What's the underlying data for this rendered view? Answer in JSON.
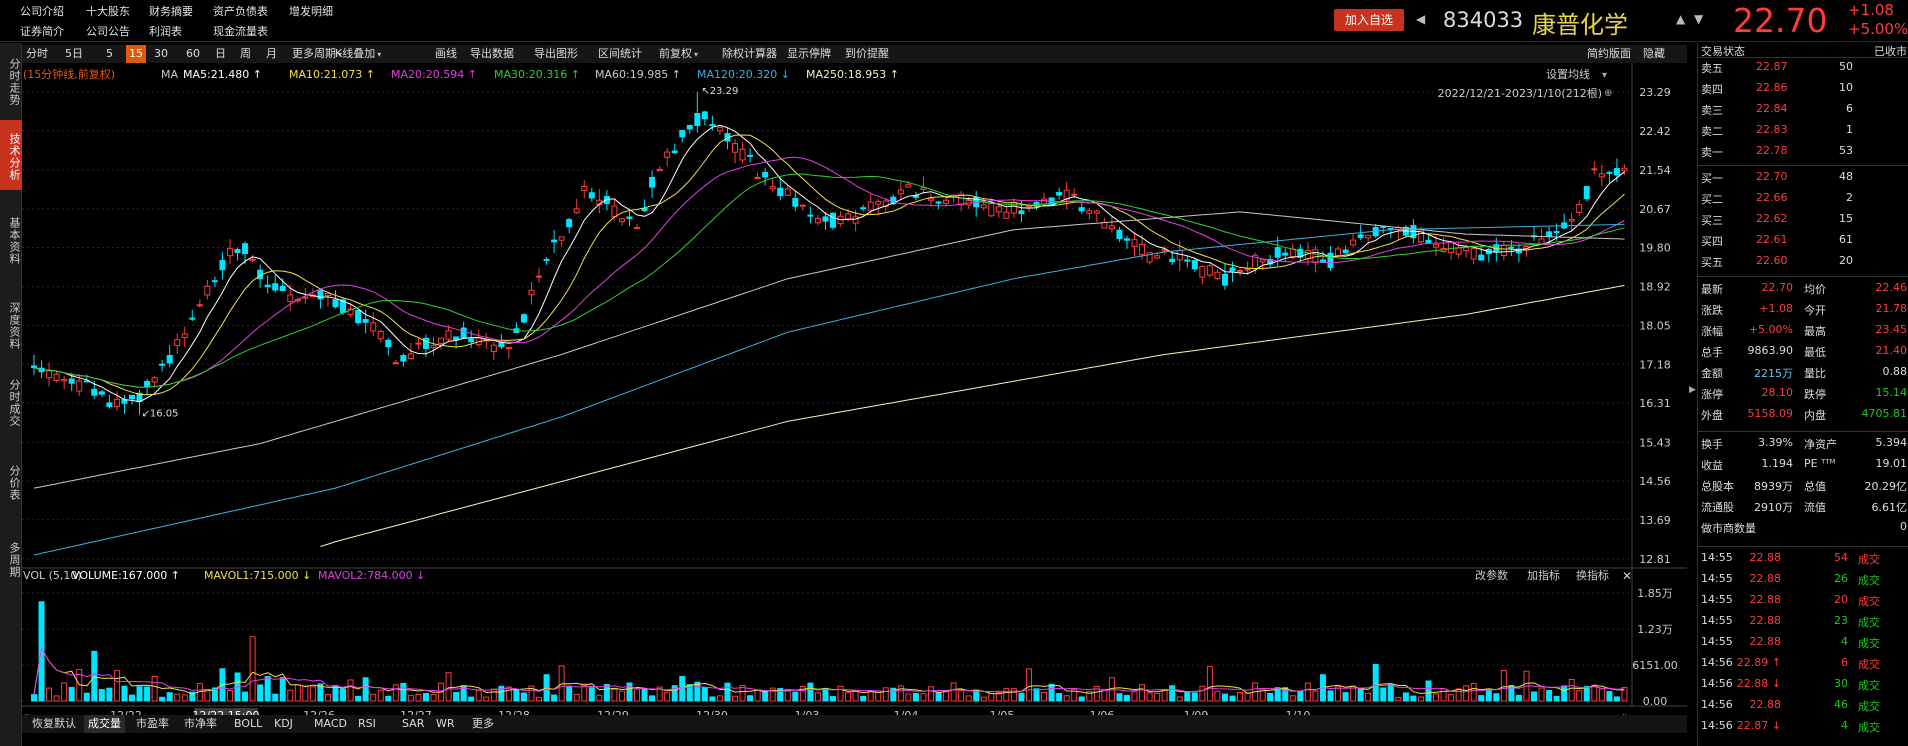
{
  "top": {
    "links_row1": [
      "公司介绍",
      "十大股东",
      "财务摘要",
      "资产负债表",
      "增发明细"
    ],
    "links_row2": [
      "证券简介",
      "公司公告",
      "利润表",
      "现金流量表"
    ],
    "add_label": "加入自选",
    "code": "834033",
    "name": "康普化学",
    "price": "22.70",
    "change": "+1.08",
    "change_pct": "+5.00%"
  },
  "lefttabs": [
    "分时走势",
    "技术分析",
    "基本资料",
    "深度资料",
    "分时成交",
    "分价表",
    "多周期"
  ],
  "toolbar": {
    "items": [
      "分时",
      "5日",
      "5",
      "15",
      "30",
      "60",
      "日",
      "周",
      "月",
      "更多周期",
      "K线叠加",
      "画线",
      "导出数据",
      "导出图形",
      "区间统计",
      "前复权",
      "除权计算器",
      "显示停牌",
      "到价提醒"
    ],
    "right": [
      "简约版面",
      "隐藏"
    ]
  },
  "ma_line": {
    "prefix": "(15分钟线,前复权)",
    "ma": "MA",
    "ma5": "MA5:21.480",
    "ma10": "MA10:21.073",
    "ma20": "MA20:20.594",
    "ma30": "MA30:20.316",
    "ma60": "MA60:19.985",
    "ma120": "MA120:20.320",
    "ma250": "MA250:18.953"
  },
  "chart_info": {
    "set_ma": "设置均线",
    "range": "2022/12/21-2023/1/10(212根)",
    "high_label": "23.29",
    "low_label": "16.05"
  },
  "price_axis": [
    "23.29",
    "22.42",
    "21.54",
    "20.67",
    "19.80",
    "18.92",
    "18.05",
    "17.18",
    "16.31",
    "15.43",
    "14.56",
    "13.69",
    "12.81"
  ],
  "vol_line": {
    "vol": "VOL (5,10)",
    "volume": "VOLUME:167.000",
    "mavol1": "MAVOL1:715.000",
    "mavol2": "MAVOL2:784.000",
    "btns": [
      "改参数",
      "加指标",
      "换指标"
    ]
  },
  "vol_axis": [
    "1.85万",
    "1.23万",
    "6151.00",
    "0.00"
  ],
  "date_axis": [
    "12/22",
    "12/26",
    "12/27",
    "12/28",
    "12/29",
    "12/30",
    "1/03",
    "1/04",
    "1/05",
    "1/06",
    "1/09",
    "1/10"
  ],
  "cursor_date": "12/22,15:00",
  "bottom_tabs": [
    "恢复默认",
    "成交量",
    "市盈率",
    "市净率",
    "BOLL",
    "KDJ",
    "MACD",
    "RSI",
    "SAR",
    "WR",
    "更多"
  ],
  "colors": {
    "up": "#ff3c3c",
    "down": "#00e5ff",
    "ma5": "#ffffff",
    "ma10": "#f0e04a",
    "ma20": "#e040e0",
    "ma30": "#30d030",
    "ma60": "#c8c8c8",
    "ma120": "#3cb0e0",
    "ma250": "#f5f0c0"
  },
  "right": {
    "title": "交易状态",
    "title_r": "已收市",
    "asks": [
      {
        "l": "卖五",
        "p": "22.87",
        "v": "50"
      },
      {
        "l": "卖四",
        "p": "22.86",
        "v": "10"
      },
      {
        "l": "卖三",
        "p": "22.84",
        "v": "6"
      },
      {
        "l": "卖二",
        "p": "22.83",
        "v": "1"
      },
      {
        "l": "卖一",
        "p": "22.78",
        "v": "53"
      }
    ],
    "bids": [
      {
        "l": "买一",
        "p": "22.70",
        "v": "48"
      },
      {
        "l": "买二",
        "p": "22.66",
        "v": "2"
      },
      {
        "l": "买三",
        "p": "22.62",
        "v": "15"
      },
      {
        "l": "买四",
        "p": "22.61",
        "v": "61"
      },
      {
        "l": "买五",
        "p": "22.60",
        "v": "20"
      }
    ],
    "stats": [
      [
        "最新",
        "22.70",
        "均价",
        "22.46"
      ],
      [
        "涨跌",
        "+1.08",
        "今开",
        "21.78"
      ],
      [
        "涨幅",
        "+5.00%",
        "最高",
        "23.45"
      ],
      [
        "总手",
        "9863.90",
        "最低",
        "21.40"
      ],
      [
        "金额",
        "2215万",
        "量比",
        "0.88"
      ],
      [
        "涨停",
        "28.10",
        "跌停",
        "15.14"
      ],
      [
        "外盘",
        "5158.09",
        "内盘",
        "4705.81"
      ]
    ],
    "stats2": [
      [
        "换手",
        "3.39%",
        "净资产",
        "5.394"
      ],
      [
        "收益",
        "1.194",
        "PE ᵀᵀᴹ",
        "19.01"
      ],
      [
        "总股本",
        "8939万",
        "总值",
        "20.29亿"
      ],
      [
        "流通股",
        "2910万",
        "流值",
        "6.61亿"
      ],
      [
        "做市商数量",
        "",
        "",
        "0"
      ]
    ],
    "trades": [
      [
        "14:55",
        "22.88",
        "54",
        "成交"
      ],
      [
        "14:55",
        "22.88",
        "26",
        "成交"
      ],
      [
        "14:55",
        "22.88",
        "20",
        "成交"
      ],
      [
        "14:55",
        "22.88",
        "23",
        "成交"
      ],
      [
        "14:55",
        "22.88",
        "4",
        "成交"
      ],
      [
        "14:56",
        "22.89 ↑",
        "6",
        "成交"
      ],
      [
        "14:56",
        "22.88 ↓",
        "30",
        "成交"
      ],
      [
        "14:56",
        "22.88",
        "46",
        "成交"
      ],
      [
        "14:56",
        "22.87 ↓",
        "4",
        "成交"
      ]
    ]
  }
}
